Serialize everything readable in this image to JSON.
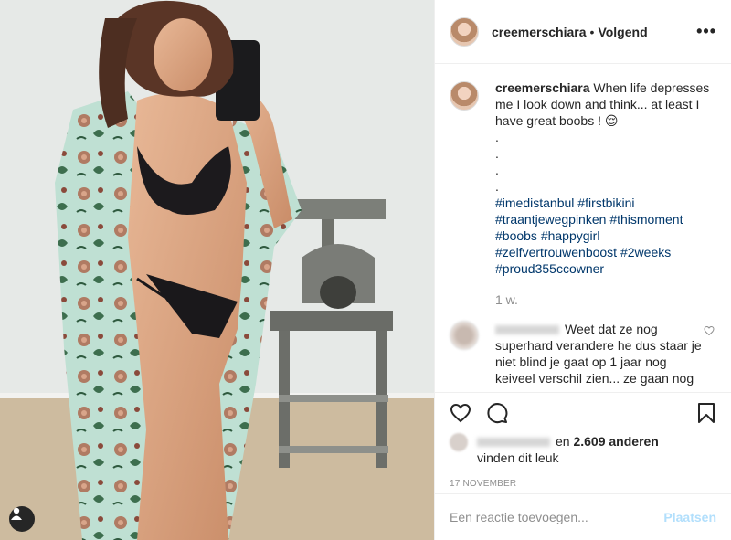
{
  "post": {
    "username": "creemerschiara",
    "follow_state": "Volgend",
    "more_label": "•••"
  },
  "caption": {
    "username": "creemerschiara",
    "text": "When life depresses me I look down and think... at least I have great boobs ! 😌",
    "dots": [
      ".",
      ".",
      ".",
      "."
    ],
    "hashtags_line1": [
      "#imedistanbul",
      "#firstbikini"
    ],
    "hashtags_line2": [
      "#traantjewegpinken",
      "#thismoment"
    ],
    "hashtags_line3": [
      "#boobs",
      "#happygirl"
    ],
    "hashtags_line4": [
      "#zelfvertrouwenboost",
      "#2weeks"
    ],
    "hashtags_line5": [
      "#proud355ccowner"
    ],
    "time": "1 w."
  },
  "comment": {
    "text": "Weet dat ze nog superhard verandere he dus staar je niet blind je gaat op 1 jaar nog keiveel verschil zien... ze gaan nog"
  },
  "likes": {
    "connector": "en",
    "count": "2.609 anderen",
    "suffix": "vinden dit leuk"
  },
  "date": "17 NOVEMBER",
  "add_comment": {
    "placeholder": "Een reactie toevoegen...",
    "post_label": "Plaatsen"
  },
  "colors": {
    "link": "#00376b",
    "post_disabled": "#b2dffc",
    "muted": "#8e8e8e"
  },
  "icons": [
    "heart-icon",
    "comment-icon",
    "bookmark-icon",
    "user-tag-icon",
    "more-icon",
    "small-heart-icon"
  ]
}
